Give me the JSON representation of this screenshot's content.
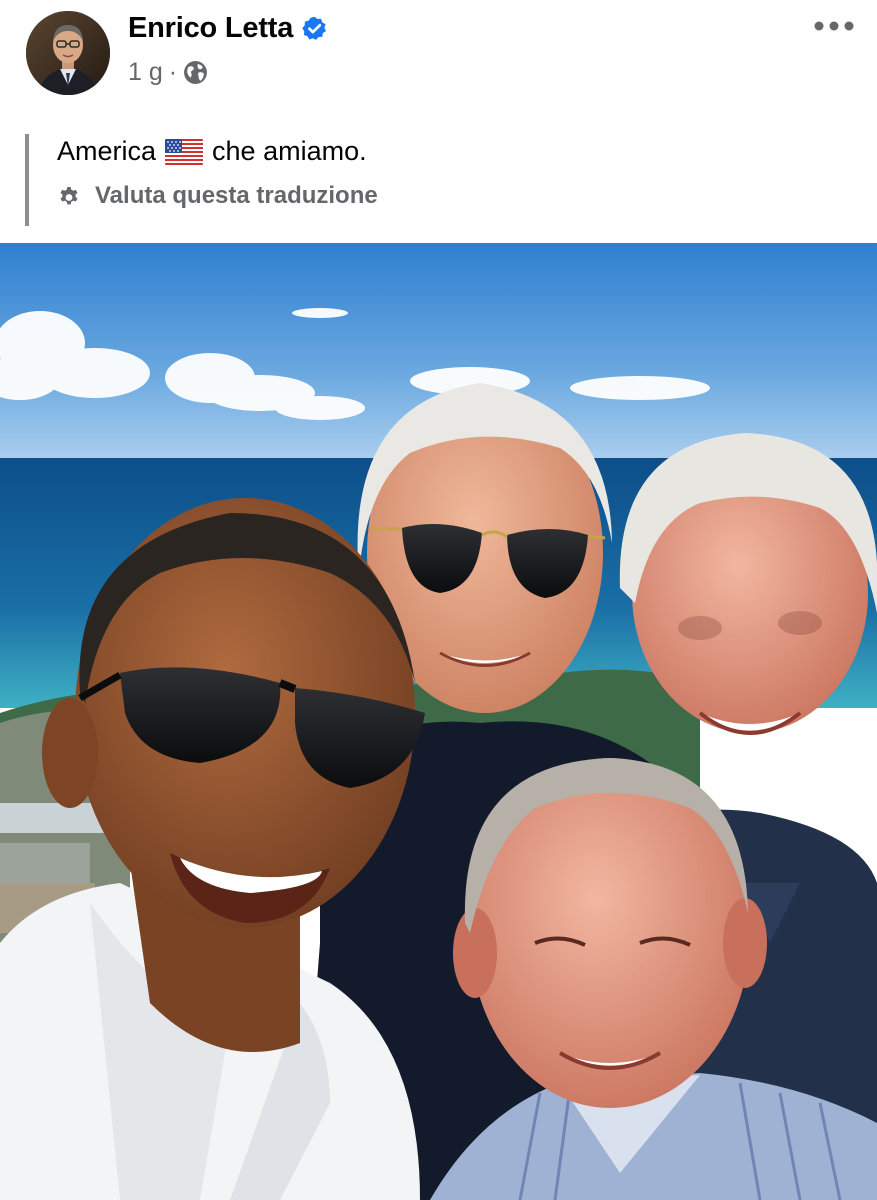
{
  "post": {
    "author": {
      "name": "Enrico Letta",
      "verified_icon": "verified-badge-icon",
      "avatar": "avatar-photo"
    },
    "meta": {
      "time": "1 g",
      "separator": "·",
      "audience_icon": "globe-icon"
    },
    "more_icon": "more-options-icon",
    "text": {
      "before_flag": "America",
      "flag_icon": "us-flag-icon",
      "after_flag": "che amiamo."
    },
    "translation": {
      "icon": "gear-icon",
      "label": "Valuta questa traduzione"
    },
    "photo": {
      "subject": "selfie-photo"
    }
  },
  "colors": {
    "text_primary": "#050505",
    "text_secondary": "#65676b",
    "verified_blue": "#1877f2",
    "quote_bar": "#8a8d91"
  }
}
